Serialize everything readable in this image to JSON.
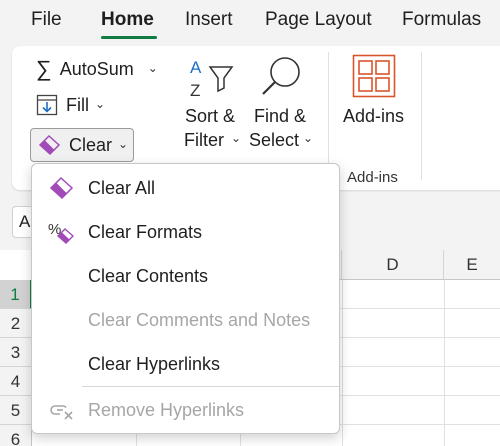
{
  "tabs": [
    {
      "label": "File"
    },
    {
      "label": "Home"
    },
    {
      "label": "Insert"
    },
    {
      "label": "Page Layout"
    },
    {
      "label": "Formulas"
    }
  ],
  "ribbon": {
    "autosum_label": "AutoSum",
    "fill_label": "Fill",
    "clear_label": "Clear",
    "sort_filter": {
      "line1": "Sort &",
      "line2": "Filter"
    },
    "find_select": {
      "line1": "Find &",
      "line2": "Select"
    },
    "addins_label": "Add-ins",
    "addins_group_label": "Add-ins"
  },
  "namebox": {
    "value": "A"
  },
  "grid": {
    "columns": [
      "D",
      "E"
    ],
    "rows": [
      "1",
      "2",
      "3",
      "4",
      "5",
      "6"
    ]
  },
  "menu": {
    "items": [
      {
        "label": "Clear All",
        "disabled": false,
        "icon": "eraser-icon"
      },
      {
        "label": "Clear Formats",
        "disabled": false,
        "icon": "clear-formats-icon"
      },
      {
        "label": "Clear Contents",
        "disabled": false,
        "icon": ""
      },
      {
        "label": "Clear Comments and Notes",
        "disabled": true,
        "icon": ""
      },
      {
        "label": "Clear Hyperlinks",
        "disabled": false,
        "icon": ""
      },
      {
        "label": "Remove Hyperlinks",
        "disabled": true,
        "icon": "remove-hyperlinks-icon"
      }
    ]
  },
  "colors": {
    "accent_green": "#107c41",
    "eraser_purple": "#a24bb8",
    "find_icon_blue": "#1f6fc5",
    "addins_orange": "#d8552b"
  }
}
